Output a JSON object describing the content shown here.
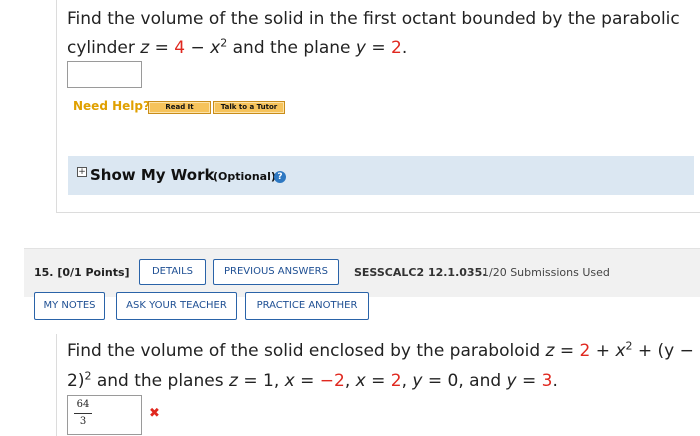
{
  "q14": {
    "line1": "Find the volume of the solid in the first octant bounded by the parabolic",
    "line2_a": "cylinder ",
    "line2_z": "z",
    "line2_eq": " = ",
    "line2_4": "4",
    "line2_minus": " − ",
    "line2_x": "x",
    "line2_sup": "2",
    "line2_b": " and the plane ",
    "line2_y": "y",
    "line2_eq2": " = ",
    "line2_2": "2",
    "line2_end": ".",
    "answer_value": "",
    "need_help": "Need Help?",
    "read_it": "Read It",
    "talk_to_tutor": "Talk to a Tutor",
    "show_my_work": "Show My Work",
    "optional": "(Optional)",
    "plus": "+",
    "help_q": "?"
  },
  "q15": {
    "points": "15.  [0/1 Points]",
    "details": "DETAILS",
    "previous_answers": "PREVIOUS ANSWERS",
    "code": "SESSCALC2 12.1.035.",
    "submissions": "1/20 Submissions Used",
    "my_notes": "MY NOTES",
    "ask_teacher": "ASK YOUR TEACHER",
    "practice_another": "PRACTICE ANOTHER",
    "l1_a": "Find the volume of the solid enclosed by the paraboloid ",
    "l1_z": "z",
    "l1_eq": " = ",
    "l1_2": "2",
    "l1_plus": " + ",
    "l1_x": "x",
    "l1_sup": "2",
    "l1_tail": " + (y −",
    "l2_a": "2)",
    "l2_sup": "2",
    "l2_b": " and the planes ",
    "l2_z": "z",
    "l2_eq1": " = ",
    "l2_1": "1",
    "l2_c1": ", ",
    "l2_x1": "x",
    "l2_eq2": " = ",
    "l2_m2": "−2",
    "l2_c2": ", ",
    "l2_x2": "x",
    "l2_eq3": " = ",
    "l2_p2": "2",
    "l2_c3": ", ",
    "l2_y1": "y",
    "l2_eq4": " = ",
    "l2_0": "0",
    "l2_and": ", and ",
    "l2_y2": "y",
    "l2_eq5": " = ",
    "l2_3": "3",
    "l2_end": ".",
    "answer_num": "64",
    "answer_den": "3",
    "incorrect": "✖"
  }
}
